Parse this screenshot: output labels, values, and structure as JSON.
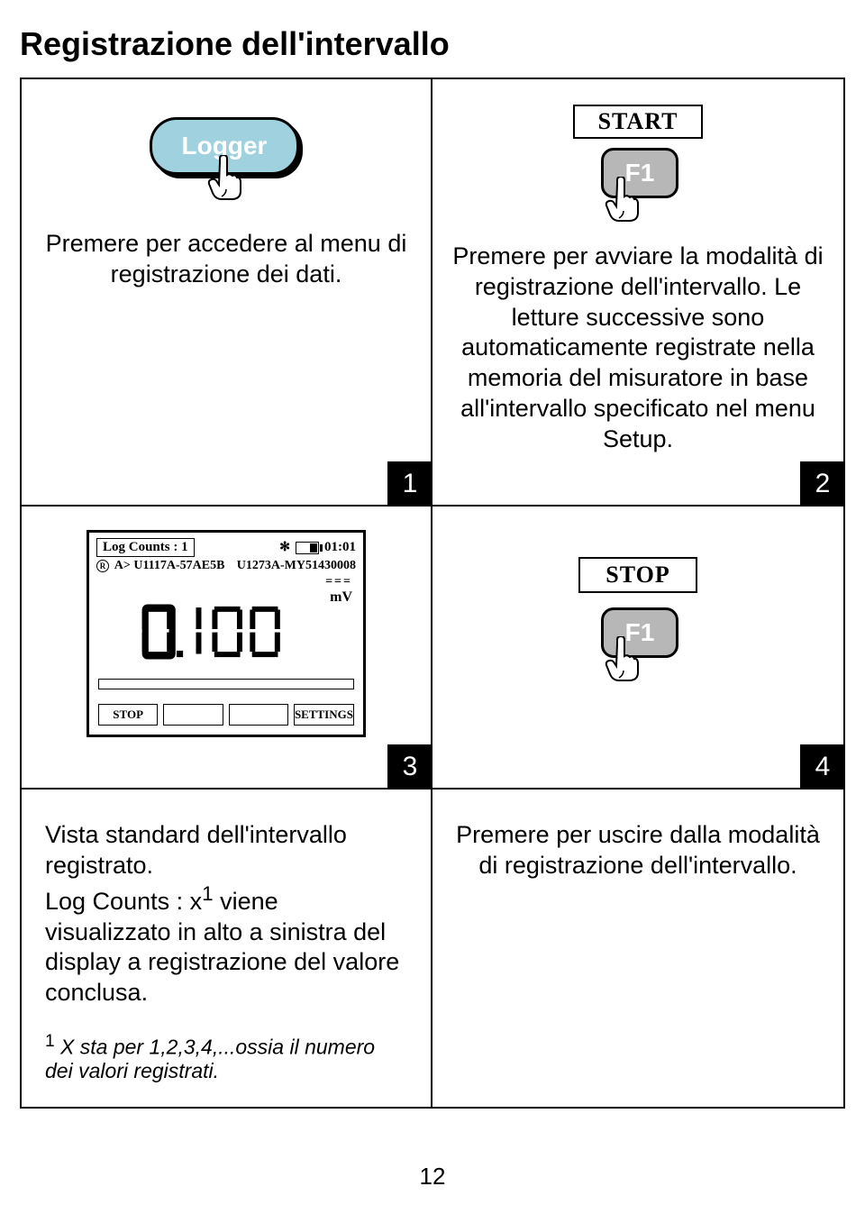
{
  "title": "Registrazione dell'intervallo",
  "page_number": "12",
  "steps": {
    "s1": "1",
    "s2": "2",
    "s3": "3",
    "s4": "4"
  },
  "step1": {
    "button_label": "Logger",
    "caption": "Premere per accedere al menu di registrazione dei dati."
  },
  "step2": {
    "start_label": "START",
    "f1_label": "F1",
    "caption": "Premere per avviare la modalità di registrazione dell'intervallo. Le letture successive sono automaticamente registrate nella memoria del misuratore in base all'intervallo specificato nel menu Setup."
  },
  "step3": {
    "log_counts_label": "Log Counts : 1",
    "clock": "01:01",
    "line2_left_prefix": "A>",
    "line2_left": "U1117A-57AE5B",
    "line2_mid": "U1273A-MY51430008",
    "unit_symbol": "===",
    "unit": "mV",
    "reading": "0.100",
    "soft_left": "STOP",
    "soft_right": "SETTINGS",
    "caption_a": "Vista standard dell'intervallo registrato.",
    "caption_b": "Log Counts : x",
    "caption_b_sup": "1",
    "caption_b_rest": " viene visualizzato in alto a sinistra del display a registrazione del valore conclusa."
  },
  "step4": {
    "stop_label": "STOP",
    "f1_label": "F1",
    "caption": "Premere per uscire dalla modalità di registrazione dell'intervallo."
  },
  "footnote_sup": "1",
  "footnote": " X sta per 1,2,3,4,...ossia il numero dei valori registrati."
}
